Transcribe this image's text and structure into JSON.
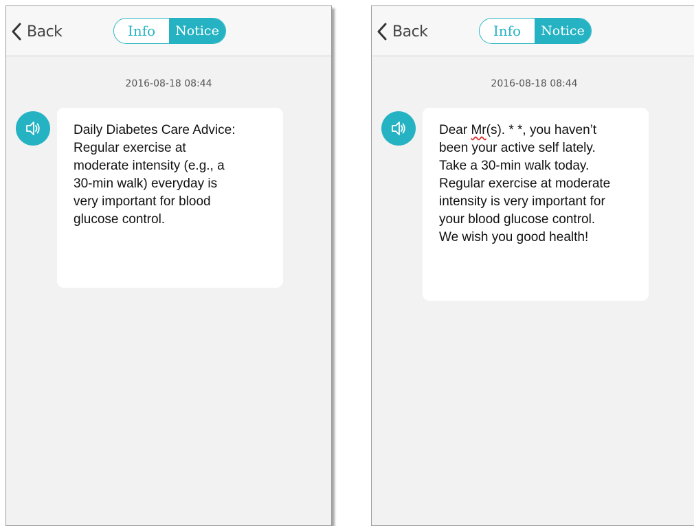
{
  "screens": [
    {
      "header": {
        "back_label": "Back",
        "tabs": [
          {
            "label": "Info",
            "selected": false
          },
          {
            "label": "Notice",
            "selected": true
          }
        ]
      },
      "message": {
        "timestamp": "2016-08-18 08:44",
        "icon": "speaker-icon",
        "text_lines": [
          "Daily Diabetes Care Advice:",
          "Regular exercise at",
          "moderate intensity (e.g., a",
          "30-min walk) everyday is",
          "very important for blood",
          "glucose control."
        ]
      }
    },
    {
      "header": {
        "back_label": "Back",
        "tabs": [
          {
            "label": "Info",
            "selected": false
          },
          {
            "label": "Notice",
            "selected": true
          }
        ]
      },
      "message": {
        "timestamp": "2016-08-18 08:44",
        "icon": "speaker-icon",
        "greeting_prefix": "Dear ",
        "greeting_title": "Mr",
        "greeting_suffix": "(s). * *, you haven’t",
        "text_lines": [
          "been your active self lately.",
          "Take a 30-min walk today.",
          "Regular exercise at moderate",
          "intensity is very important for",
          "your blood glucose control.",
          "We wish you good health!"
        ]
      }
    }
  ],
  "colors": {
    "accent": "#25b3c3",
    "background": "#f2f2f2",
    "bubble": "#ffffff"
  }
}
